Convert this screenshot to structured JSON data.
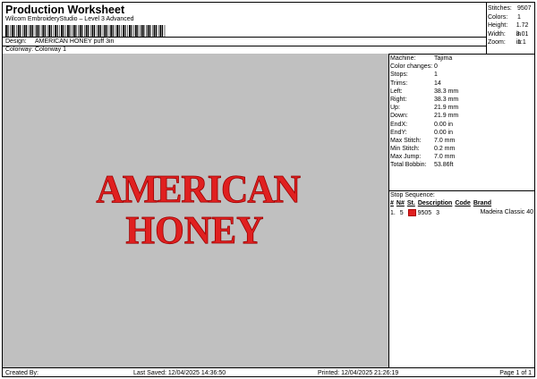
{
  "header": {
    "title": "Production Worksheet",
    "subtitle": "Wilcom EmbroideryStudio – Level 3 Advanced"
  },
  "stats": [
    {
      "label": "Stitches:",
      "value": "9507"
    },
    {
      "label": "Colors:",
      "value": "1"
    },
    {
      "label": "Height:",
      "value": "1.72 in"
    },
    {
      "label": "Width:",
      "value": "3.01 in"
    },
    {
      "label": "Zoom:",
      "value": "1:1"
    }
  ],
  "design": {
    "label": "Design:",
    "value": "AMERICAN HONEY puff 3in"
  },
  "colorway": {
    "label": "Colorway:",
    "value": "Colorway 1"
  },
  "preview": {
    "line1": "AMERICAN",
    "line2": "HONEY",
    "color": "#e02020"
  },
  "machine_info": [
    {
      "label": "Machine:",
      "value": "Tajima"
    },
    {
      "label": "Color changes:",
      "value": "0"
    },
    {
      "label": "Stops:",
      "value": "1"
    },
    {
      "label": "Trims:",
      "value": "14"
    },
    {
      "label": "Left:",
      "value": "38.3 mm"
    },
    {
      "label": "Right:",
      "value": "38.3 mm"
    },
    {
      "label": "Up:",
      "value": "21.9 mm"
    },
    {
      "label": "Down:",
      "value": "21.9 mm"
    },
    {
      "label": "EndX:",
      "value": "0.00 in"
    },
    {
      "label": "EndY:",
      "value": "0.00 in"
    },
    {
      "label": "Max Stitch:",
      "value": "7.0 mm"
    },
    {
      "label": "Min Stitch:",
      "value": "0.2 mm"
    },
    {
      "label": "Max Jump:",
      "value": "7.0 mm"
    },
    {
      "label": "Total Bobbin:",
      "value": "53.86ft"
    }
  ],
  "stop_sequence": {
    "title": "Stop Sequence:",
    "headers": [
      "#",
      "N#",
      "St.",
      "Description",
      "Code",
      "Brand"
    ],
    "rows": [
      {
        "index": "1.",
        "n": "5",
        "swatch_color": "#e02020",
        "stitches": "9505",
        "code": "3",
        "brand": "Madeira Classic 40"
      }
    ]
  },
  "footer": {
    "created_by": "Created By:",
    "last_saved": "Last Saved: 12/04/2025 14:36:50",
    "printed": "Printed: 12/04/2025 21:26:19",
    "page": "Page 1 of 1"
  }
}
